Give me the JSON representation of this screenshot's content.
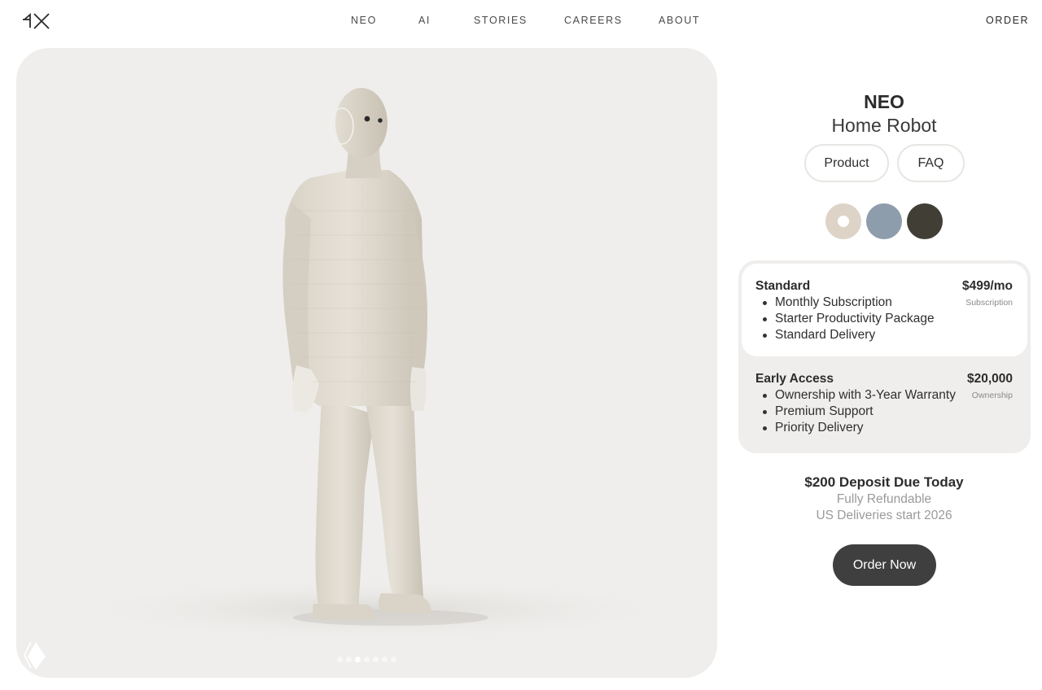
{
  "header": {
    "logo_icon": "1x-logo-icon",
    "nav": [
      "NEO",
      "AI",
      "STORIES",
      "CAREERS",
      "ABOUT"
    ],
    "order_label": "ORDER"
  },
  "hero": {
    "image": "neo-humanoid-robot-figure",
    "carousel": {
      "slides": 7,
      "active": 3
    }
  },
  "product": {
    "name": "NEO",
    "subtitle": "Home Robot",
    "tabs": [
      "Product",
      "FAQ"
    ],
    "colors": [
      {
        "hex": "#ddd3c7",
        "selected": true
      },
      {
        "hex": "#8e9dab",
        "selected": false
      },
      {
        "hex": "#413e36",
        "selected": false
      }
    ]
  },
  "plans": [
    {
      "name": "Standard",
      "features": [
        "Monthly Subscription",
        "Starter Productivity Package",
        "Standard Delivery"
      ],
      "price": "$499/mo",
      "price_note": "Subscription",
      "selected": true
    },
    {
      "name": "Early Access",
      "features": [
        "Ownership with 3-Year Warranty",
        "Premium Support",
        "Priority Delivery"
      ],
      "price": "$20,000",
      "price_note": "Ownership",
      "selected": false
    }
  ],
  "deposit": {
    "title": "$200 Deposit Due Today",
    "line1": "Fully Refundable",
    "line2": "US Deliveries start 2026"
  },
  "cta": {
    "label": "Order Now"
  },
  "colors": {
    "accent": "#3f3f3f",
    "panel_bg": "#efeeec"
  }
}
